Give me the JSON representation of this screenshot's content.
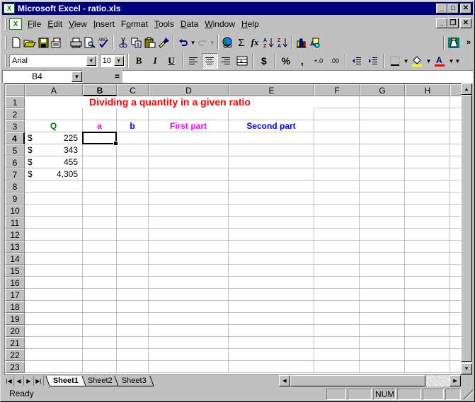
{
  "window": {
    "title": "Microsoft Excel - ratio.xls",
    "caption_buttons": [
      "minimize",
      "maximize",
      "close"
    ],
    "doc_buttons": [
      "minimize",
      "restore",
      "close"
    ]
  },
  "menubar": {
    "items": [
      "File",
      "Edit",
      "View",
      "Insert",
      "Format",
      "Tools",
      "Data",
      "Window",
      "Help"
    ]
  },
  "standard_toolbar": {
    "buttons": [
      "new-icon",
      "open-icon",
      "save-icon",
      "email-icon",
      "print-icon",
      "print-preview-icon",
      "spelling-icon",
      "cut-icon",
      "copy-icon",
      "paste-icon",
      "format-painter-icon",
      "undo-icon",
      "redo-icon",
      "hyperlink-icon",
      "autosum-icon",
      "function-icon",
      "sort-ascending-icon",
      "sort-descending-icon",
      "chart-wizard-icon",
      "drawing-icon",
      "office-assistant-icon",
      "more-buttons-icon"
    ],
    "glyphs": {
      "autosum": "Σ",
      "function": "fx",
      "sort_asc": "A↓",
      "sort_desc": "Z↓",
      "more": "»"
    }
  },
  "formatting_toolbar": {
    "font_name": "Arial",
    "font_size": "10",
    "bold": "B",
    "italic": "I",
    "underline": "U",
    "currency": "$",
    "percent": "%",
    "comma": ",",
    "increase_decimal": "+.0",
    "decrease_decimal": ".00",
    "fill_color": "#ffff00",
    "font_color": "#ff0000"
  },
  "formula_bar": {
    "name_box": "B4",
    "equals": "=",
    "formula": ""
  },
  "sheet": {
    "columns": [
      "A",
      "B",
      "C",
      "D",
      "E",
      "F",
      "G",
      "H"
    ],
    "active_column": "B",
    "rows": [
      "1",
      "2",
      "3",
      "4",
      "5",
      "6",
      "7",
      "8",
      "9",
      "10",
      "11",
      "12",
      "13",
      "14",
      "15",
      "16",
      "17",
      "18",
      "19",
      "20",
      "21",
      "22",
      "23"
    ],
    "active_row": "4",
    "title": {
      "text": "Dividing a quantity in a given ratio",
      "color": "#ff0000"
    },
    "headers": [
      {
        "col": "A",
        "text": "Q",
        "color": "#008000"
      },
      {
        "col": "B",
        "text": "a",
        "color": "#ff00ff"
      },
      {
        "col": "C",
        "text": "b",
        "color": "#0000ff"
      },
      {
        "col": "D",
        "text": "First part",
        "color": "#ff00ff"
      },
      {
        "col": "E",
        "text": "Second part",
        "color": "#0000ff"
      }
    ],
    "quantities": [
      {
        "row": "4",
        "currency": "$",
        "value": "225"
      },
      {
        "row": "5",
        "currency": "$",
        "value": "343"
      },
      {
        "row": "6",
        "currency": "$",
        "value": "455"
      },
      {
        "row": "7",
        "currency": "$",
        "value": "4,305"
      }
    ],
    "selected_cell": "B4"
  },
  "sheet_tabs": {
    "tabs": [
      "Sheet1",
      "Sheet2",
      "Sheet3"
    ],
    "active": "Sheet1"
  },
  "statusbar": {
    "status": "Ready",
    "indicators": [
      "",
      "",
      "NUM",
      "",
      "",
      ""
    ]
  }
}
